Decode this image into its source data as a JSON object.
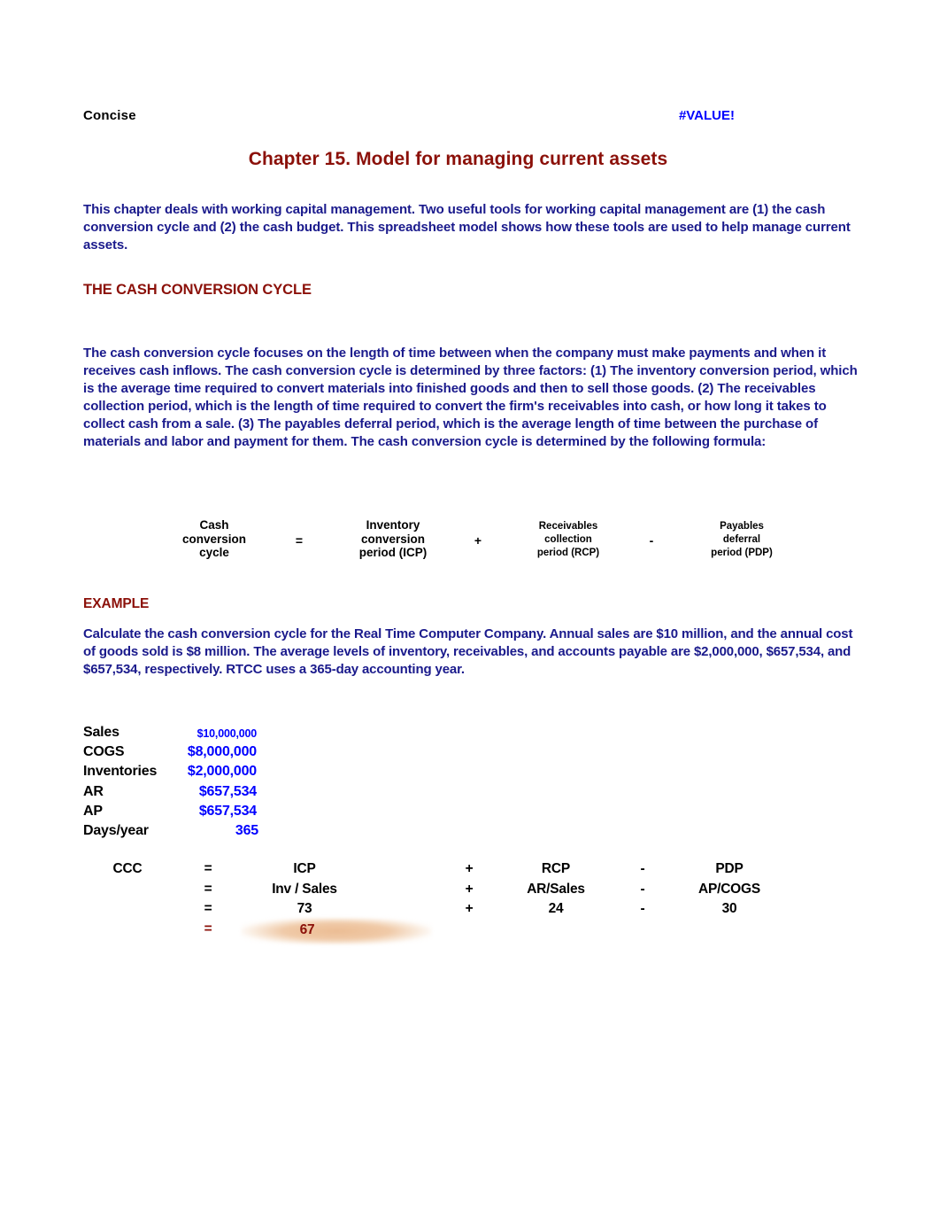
{
  "header": {
    "left_label": "Concise",
    "error_value": "#VALUE!",
    "error_color": "#0000ff"
  },
  "title": "Chapter 15.  Model for managing current assets",
  "title_color": "#8b1009",
  "body_color": "#1a1a8c",
  "intro_paragraph": "This chapter deals with working capital management. Two useful tools for working capital management are (1) the cash conversion cycle and (2) the cash budget.  This spreadsheet model shows how these tools are used to help manage current assets.",
  "sections": {
    "cash_conversion_cycle_heading": "THE CASH CONVERSION CYCLE",
    "cash_conversion_cycle_body": "The cash conversion cycle focuses on the length of time between when the company must make payments and when it receives cash inflows.  The cash conversion cycle is determined by three factors: (1) The inventory conversion period, which is the average time required to convert materials into finished goods and then to sell those goods.  (2) The receivables collection period, which is the length of time required to convert the firm's receivables into cash, or how long it takes to collect cash from a sale.  (3) The payables deferral period, which is the average length of time between the purchase of materials and labor and payment for them.  The cash conversion cycle is determined by the following formula:",
    "example_heading": "EXAMPLE",
    "example_body": "Calculate the cash conversion cycle for the Real Time Computer Company.  Annual sales are $10 million, and the annual cost of goods sold is $8 million.  The average levels of inventory, receivables, and accounts payable are $2,000,000, $657,534, and $657,534, respectively. RTCC uses a 365-day accounting year."
  },
  "formula": {
    "term1_line1": "Cash",
    "term1_line2": "conversion",
    "term1_line3": "cycle",
    "operator1": "=",
    "term2_line1": "Inventory",
    "term2_line2": "conversion",
    "term2_line3": "period (ICP)",
    "operator2": "+",
    "term3_line1": "Receivables",
    "term3_line2": "collection",
    "term3_line3": "period (RCP)",
    "operator3": "-",
    "term4_line1": "Payables",
    "term4_line2": "deferral",
    "term4_line3": "period (PDP)"
  },
  "inputs": [
    {
      "label": "Sales",
      "value": "$10,000,000"
    },
    {
      "label": "COGS",
      "value": "$8,000,000"
    },
    {
      "label": "Inventories",
      "value": "$2,000,000"
    },
    {
      "label": "AR",
      "value": "$657,534"
    },
    {
      "label": "AP",
      "value": "$657,534"
    },
    {
      "label": "Days/year",
      "value": "365"
    }
  ],
  "calculation": {
    "row_label": "CCC",
    "rows": [
      {
        "eq": "=",
        "icp": "ICP",
        "plus": "+",
        "rcp": "RCP",
        "minus": "-",
        "pdp": "PDP"
      },
      {
        "eq": "=",
        "icp": "Inv / Sales",
        "plus": "+",
        "rcp": "AR/Sales",
        "minus": "-",
        "pdp": "AP/COGS"
      },
      {
        "eq": "=",
        "icp": "73",
        "plus": "+",
        "rcp": "24",
        "minus": "-",
        "pdp": "30"
      }
    ],
    "result_eq": "=",
    "result_value": "67",
    "result_color": "#8b1009",
    "result_highlight_color": "#ebba8f"
  }
}
